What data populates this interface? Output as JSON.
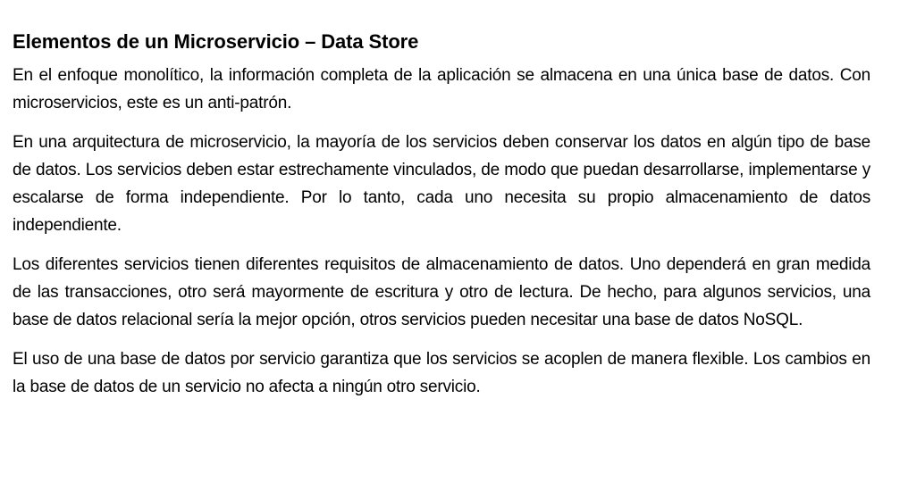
{
  "document": {
    "title": "Elementos de un Microservicio – Data Store",
    "paragraphs": [
      "En el enfoque monolítico, la información completa de la aplicación se almacena en una única base de datos. Con microservicios, este es un anti-patrón.",
      "En una arquitectura de microservicio, la mayoría de los servicios deben conservar los datos en algún tipo de base de datos. Los servicios deben estar estrechamente vinculados, de modo que puedan desarrollarse, implementarse y escalarse de forma independiente. Por lo tanto, cada uno necesita su propio almacenamiento de datos independiente.",
      "Los diferentes servicios tienen diferentes requisitos de almacenamiento de datos. Uno dependerá en gran medida de las transacciones, otro será mayormente de escritura y otro de lectura. De hecho, para algunos servicios, una base de datos relacional sería la mejor opción, otros servicios pueden necesitar una base de datos NoSQL.",
      "El uso de una base de datos por servicio garantiza que los servicios se acoplen de manera flexible. Los cambios en la base de datos de un servicio no afecta a ningún otro servicio."
    ]
  }
}
